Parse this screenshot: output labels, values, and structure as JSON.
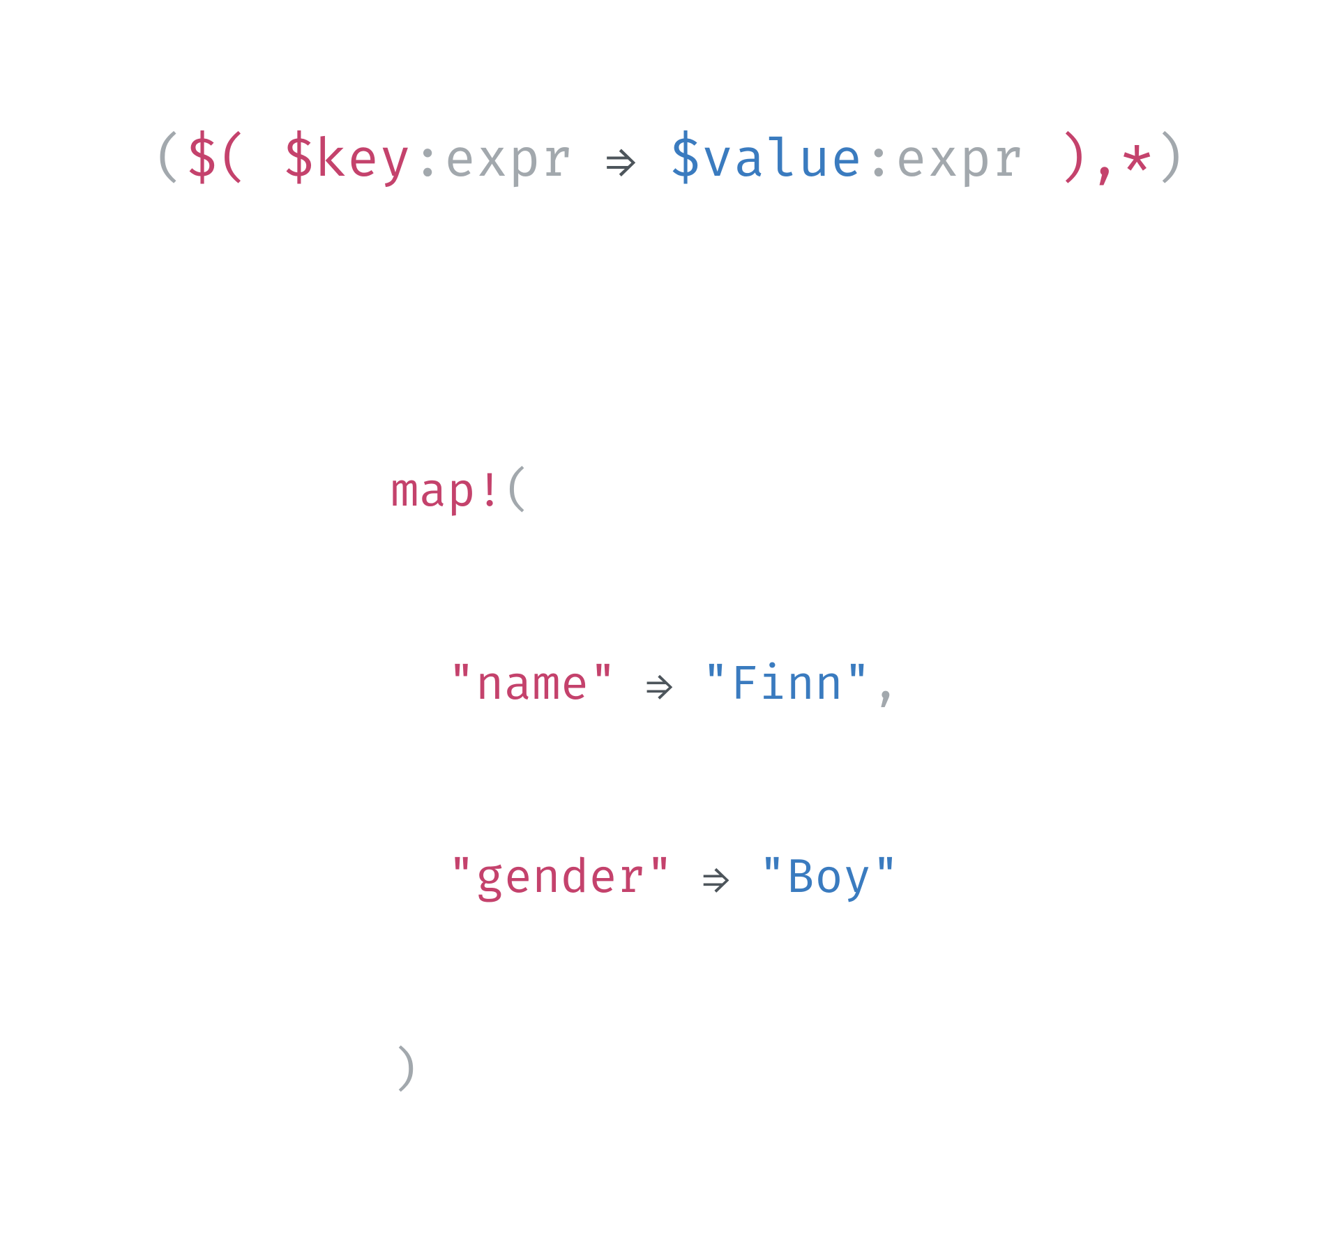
{
  "pattern": {
    "p01": "(",
    "p02": "$( $key",
    "p03": ":expr ",
    "p04": "⇒",
    "p05": " ",
    "p06": "$value",
    "p07": ":expr ",
    "p08": "),*",
    "p09": ")"
  },
  "example": {
    "l1a": "map!",
    "l1b": "(",
    "l2a": "  ",
    "l2b": "\"name\"",
    "l2c": " ",
    "l2d": "⇒",
    "l2e": " ",
    "l2f": "\"Finn\"",
    "l2g": ",",
    "l3a": "  ",
    "l3b": "\"gender\"",
    "l3c": " ",
    "l3d": "⇒",
    "l3e": " ",
    "l3f": "\"Boy\"",
    "l4a": ")"
  }
}
